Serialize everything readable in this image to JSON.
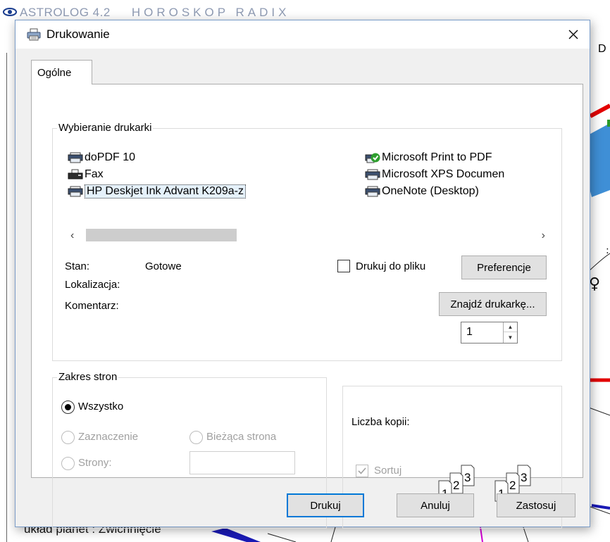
{
  "background": {
    "app_title": "ASTROLOG 4.2",
    "chart_title": "HOROSKOP RADIX",
    "toolbar_letter": "D",
    "bottom_text": "układ planet : Zwichnięcie"
  },
  "dialog": {
    "title": "Drukowanie",
    "close_glyph": "✕",
    "tabs": [
      {
        "label": "Ogólne"
      }
    ],
    "printer_group": {
      "label": "Wybieranie drukarki",
      "printers": [
        {
          "name": "doPDF 10",
          "icon": "printer-icon"
        },
        {
          "name": "Fax",
          "icon": "fax-icon"
        },
        {
          "name": "HP Deskjet Ink Advant K209a-z",
          "icon": "printer-icon",
          "selected": true
        },
        {
          "name": "Microsoft Print to PDF",
          "icon": "default-printer-icon",
          "default": true
        },
        {
          "name": "Microsoft XPS Documen",
          "icon": "printer-icon"
        },
        {
          "name": "OneNote (Desktop)",
          "icon": "printer-icon"
        }
      ],
      "scroll_left": "‹",
      "scroll_right": "›",
      "status_label": "Stan:",
      "status_value": "Gotowe",
      "location_label": "Lokalizacja:",
      "location_value": "",
      "comment_label": "Komentarz:",
      "comment_value": "",
      "print_to_file_label": "Drukuj do pliku",
      "print_to_file_checked": false,
      "preferences_button": "Preferencje",
      "find_printer_button": "Znajdź drukarkę..."
    },
    "page_range": {
      "label": "Zakres stron",
      "options": {
        "all": "Wszystko",
        "selection": "Zaznaczenie",
        "current": "Bieżąca strona",
        "pages": "Strony:"
      },
      "selected": "all",
      "pages_value": ""
    },
    "copies": {
      "label": "Liczba kopii:",
      "value": "1",
      "collate_label": "Sortuj",
      "collate_checked": true,
      "collate_icon_digits": [
        "1",
        "2",
        "3"
      ]
    },
    "buttons": {
      "print": "Drukuj",
      "cancel": "Anuluj",
      "apply": "Zastosuj"
    }
  },
  "colors": {
    "dialog_bg": "#f0f0f0",
    "accent": "#0078d7",
    "selection_bg": "#e5f1fb",
    "default_printer_check": "#2e9e2e"
  }
}
